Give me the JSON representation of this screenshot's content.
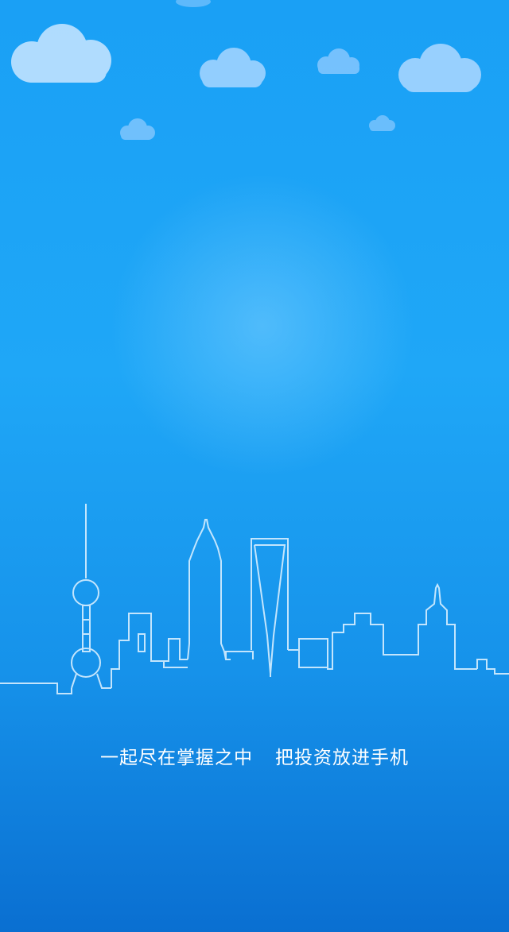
{
  "slogan": {
    "part1": "一起尽在掌握之中",
    "part2": "把投资放进手机"
  },
  "colors": {
    "background_top": "#1aa0f5",
    "background_bottom": "#0a6fd1",
    "cloud": "#a9d9ff",
    "skyline_line": "#d6eeff",
    "text": "#ffffff"
  }
}
